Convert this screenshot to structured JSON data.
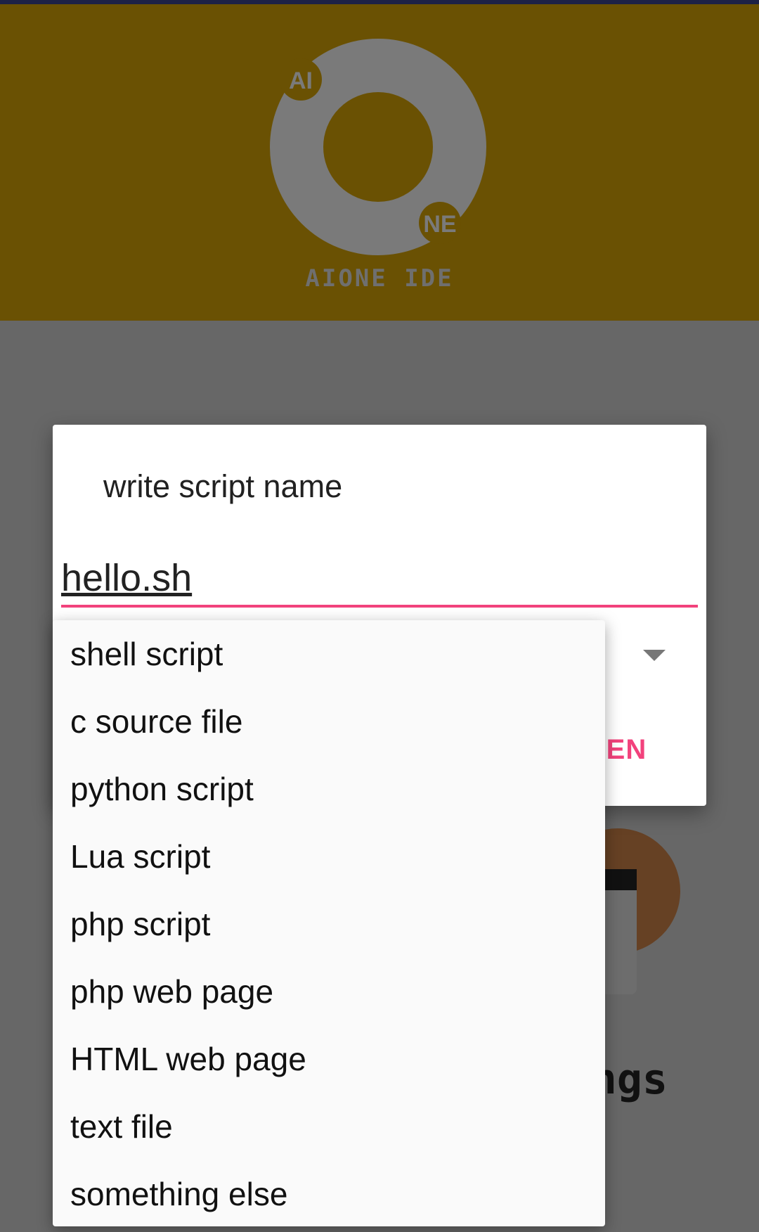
{
  "app": {
    "logo_corner_top": "AI",
    "logo_corner_bottom": "NE",
    "logo_caption": "AIONE IDE"
  },
  "background": {
    "settings_label": "ngs"
  },
  "dialog": {
    "title": "write script name",
    "name_value": "hello.sh",
    "open_button_label": "PEN",
    "accent_color": "#f2427c"
  },
  "dropdown": {
    "options": [
      "shell script",
      "c source file",
      "python script",
      "Lua script",
      "php script",
      "php web page",
      "HTML web page",
      "text file",
      "something else"
    ]
  },
  "colors": {
    "header": "#6a5103",
    "scrim": "#676767",
    "logo": "#7a7a7a"
  }
}
